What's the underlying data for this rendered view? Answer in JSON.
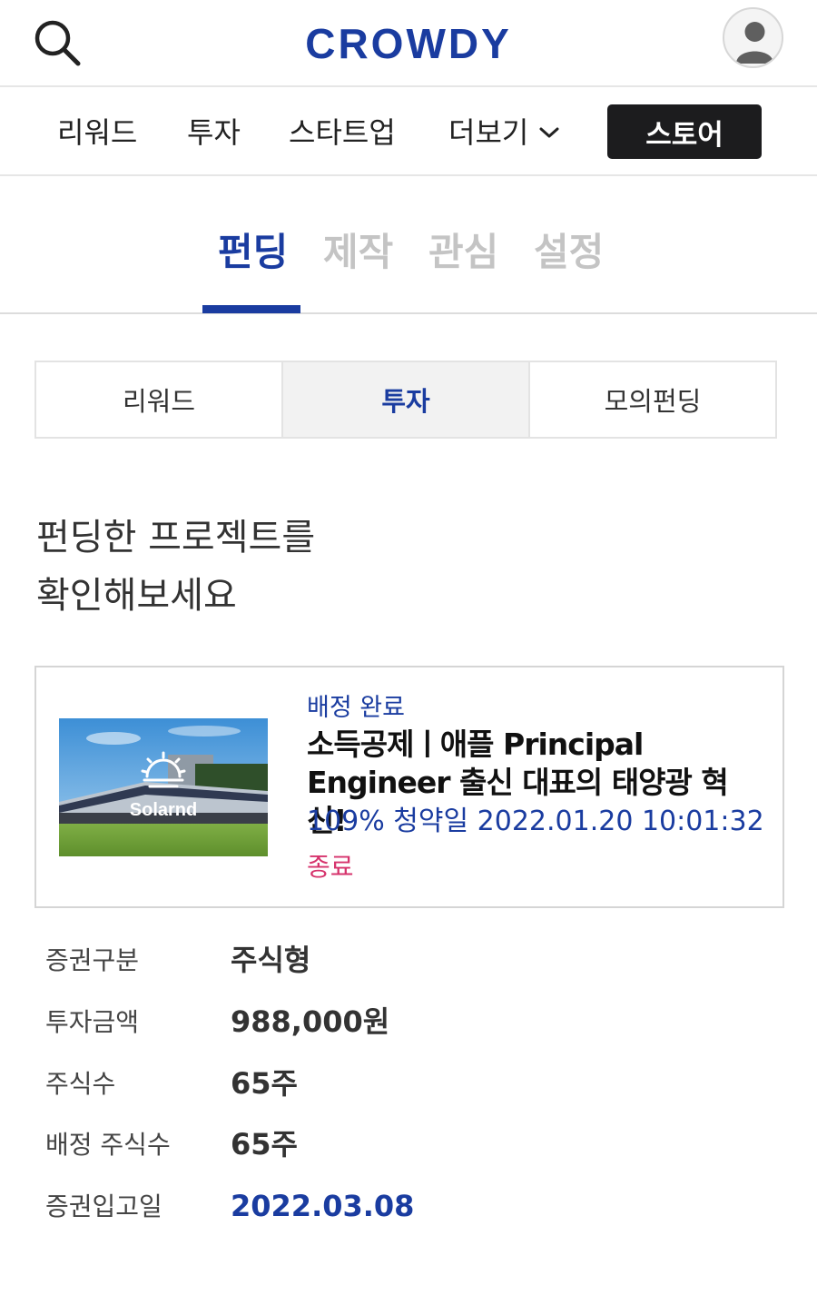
{
  "header": {
    "logo": "CROWDY",
    "search_icon": "search-icon",
    "avatar_icon": "user-avatar-icon"
  },
  "main_nav": {
    "items": [
      "리워드",
      "투자",
      "스타트업",
      "더보기"
    ],
    "more_icon": "chevron-down-icon",
    "store_label": "스토어"
  },
  "section_tabs": {
    "items": [
      "펀딩",
      "제작",
      "관심",
      "설정"
    ],
    "active": "펀딩"
  },
  "sub_tabs": {
    "items": [
      "리워드",
      "투자",
      "모의펀딩"
    ],
    "active": "투자"
  },
  "headline": {
    "line1": "펀딩한 프로젝트를",
    "line2": "확인해보세요"
  },
  "project": {
    "thumbnail_text": "Solarnd",
    "status": "배정 완료",
    "title_line1": "소득공제ㅣ애플 Principal",
    "title_line2": "Engineer 출신 대표의 태양광 혁신!",
    "progress": "109% 청약일 2022.01.20 10:01:32",
    "end_label": "종료"
  },
  "details": [
    {
      "label": "증권구분",
      "value": "주식형"
    },
    {
      "label": "투자금액",
      "value": "988,000원"
    },
    {
      "label": "주식수",
      "value": "65주"
    },
    {
      "label": "배정 주식수",
      "value": "65주"
    },
    {
      "label": "증권입고일",
      "value": "2022.03.08"
    }
  ],
  "colors": {
    "brand": "#1a3ca0",
    "end_status": "#d6336c",
    "store_button": "#1c1c1e"
  }
}
